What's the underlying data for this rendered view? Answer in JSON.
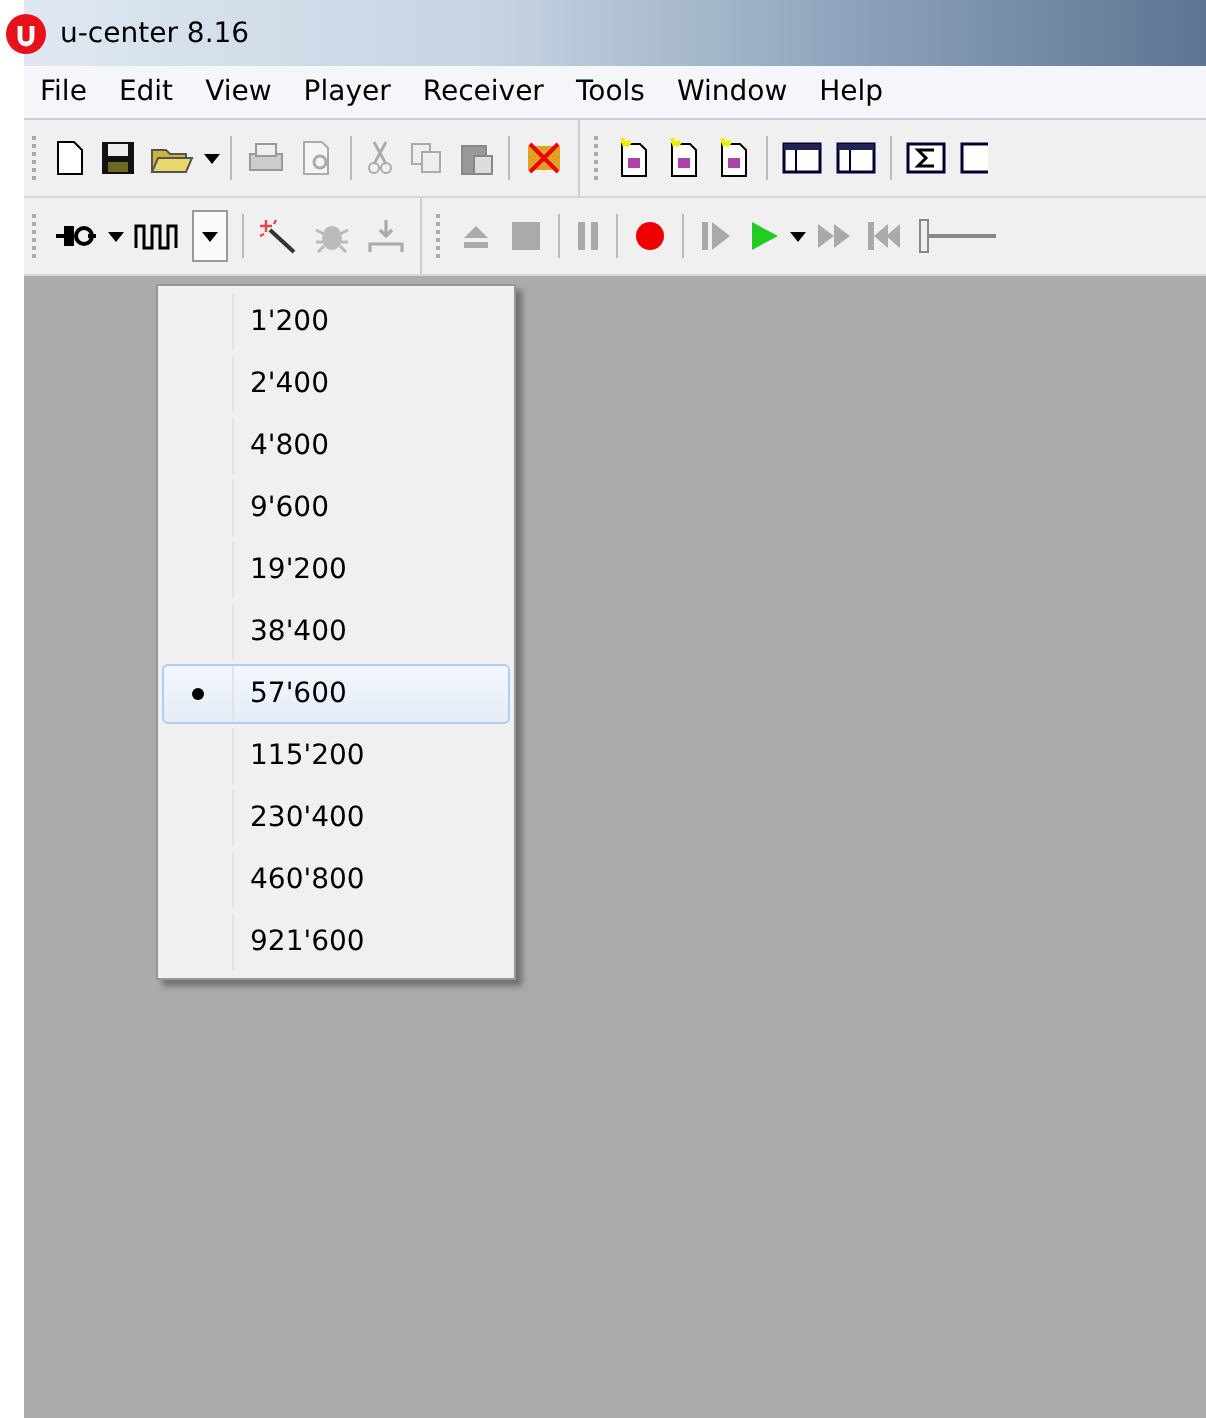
{
  "window": {
    "title": "u-center 8.16"
  },
  "menu_bar": [
    "File",
    "Edit",
    "View",
    "Player",
    "Receiver",
    "Tools",
    "Window",
    "Help"
  ],
  "baudrate_menu": {
    "items": [
      {
        "label": "1'200",
        "selected": false
      },
      {
        "label": "2'400",
        "selected": false
      },
      {
        "label": "4'800",
        "selected": false
      },
      {
        "label": "9'600",
        "selected": false
      },
      {
        "label": "19'200",
        "selected": false
      },
      {
        "label": "38'400",
        "selected": false
      },
      {
        "label": "57'600",
        "selected": true
      },
      {
        "label": "115'200",
        "selected": false
      },
      {
        "label": "230'400",
        "selected": false
      },
      {
        "label": "460'800",
        "selected": false
      },
      {
        "label": "921'600",
        "selected": false
      }
    ]
  }
}
